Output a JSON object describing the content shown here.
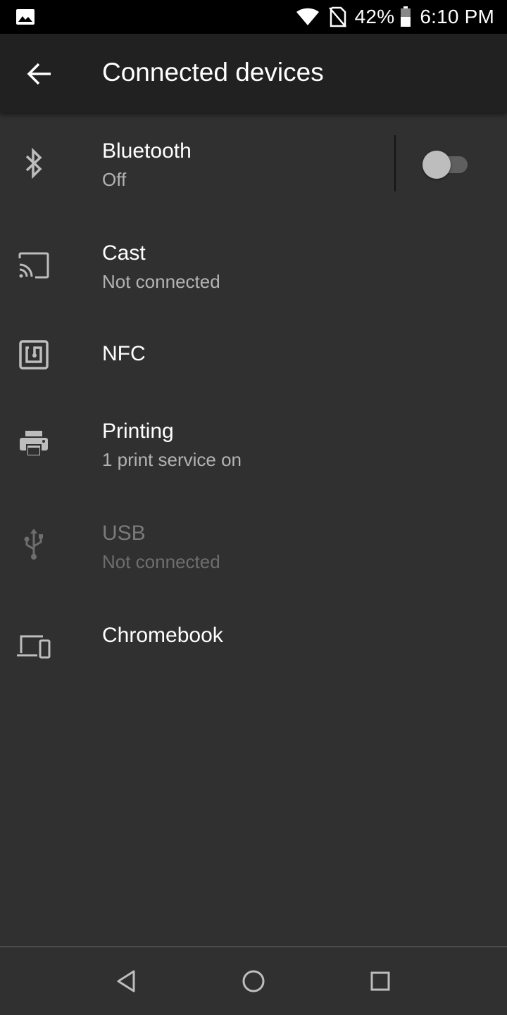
{
  "status_bar": {
    "battery_percent": "42%",
    "time": "6:10 PM",
    "icons": [
      "gallery-icon",
      "wifi-icon",
      "no-sim-icon",
      "battery-icon"
    ]
  },
  "app_bar": {
    "title": "Connected devices",
    "back_icon": "arrow-back-icon"
  },
  "items": [
    {
      "id": "bluetooth",
      "title": "Bluetooth",
      "summary": "Off",
      "icon": "bluetooth-icon",
      "toggle": false,
      "enabled": true
    },
    {
      "id": "cast",
      "title": "Cast",
      "summary": "Not connected",
      "icon": "cast-icon",
      "enabled": true
    },
    {
      "id": "nfc",
      "title": "NFC",
      "summary": "",
      "icon": "nfc-icon",
      "enabled": true
    },
    {
      "id": "printing",
      "title": "Printing",
      "summary": "1 print service on",
      "icon": "printer-icon",
      "enabled": true
    },
    {
      "id": "usb",
      "title": "USB",
      "summary": "Not connected",
      "icon": "usb-icon",
      "enabled": false
    },
    {
      "id": "chromebook",
      "title": "Chromebook",
      "summary": "",
      "icon": "devices-icon",
      "enabled": true
    }
  ],
  "nav_bar": {
    "buttons": [
      "back-triangle-icon",
      "home-circle-icon",
      "recents-square-icon"
    ]
  },
  "colors": {
    "background": "#303030",
    "app_bar": "#212121",
    "text_primary": "#ffffff",
    "text_secondary": "#b3b3b3",
    "text_disabled": "#7a7a7a"
  }
}
